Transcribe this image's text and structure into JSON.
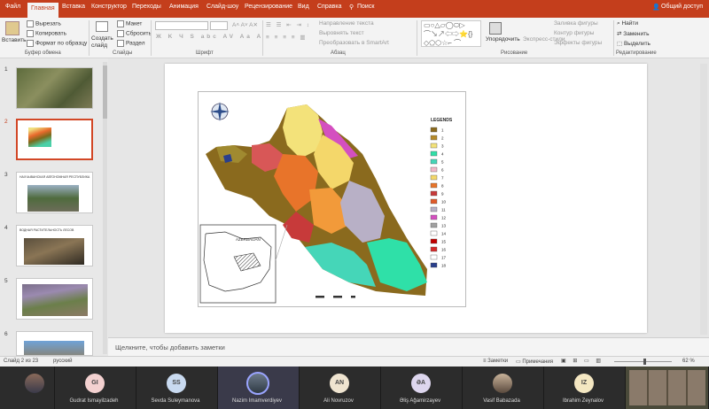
{
  "tabs": [
    "Файл",
    "Главная",
    "Вставка",
    "Конструктор",
    "Переходы",
    "Анимация",
    "Слайд-шоу",
    "Рецензирование",
    "Вид",
    "Справка",
    "Поиск"
  ],
  "share": "Общий доступ",
  "ribbon": {
    "paste": "Вставить",
    "cut": "Вырезать",
    "copy": "Копировать",
    "format": "Формат по образцу",
    "clipboard": "Буфер обмена",
    "new_slide": "Создать слайд",
    "layout": "Макет",
    "reset": "Сбросить",
    "section": "Раздел",
    "slides": "Слайды",
    "font": "Шрифт",
    "paragraph": "Абзац",
    "text_dir": "Направление текста",
    "align_text": "Выровнять текст",
    "smartart": "Преобразовать в SmartArt",
    "arrange": "Упорядочить",
    "quick_styles": "Экспресс-стили",
    "fill": "Заливка фигуры",
    "outline": "Контур фигуры",
    "effects": "Эффекты фигуры",
    "drawing": "Рисование",
    "find": "Найти",
    "replace": "Заменить",
    "select": "Выделить",
    "editing": "Редактирование"
  },
  "thumbnails": [
    {
      "num": "1",
      "caption": ""
    },
    {
      "num": "2",
      "caption": ""
    },
    {
      "num": "3",
      "caption": "НАХЧЫВАНСКАЯ АВТОНОМНАЯ РЕСПУБЛИКА"
    },
    {
      "num": "4",
      "caption": "ВОДНАЯ РАСТИТЕЛЬНОСТЬ ЛЕСОВ"
    },
    {
      "num": "5",
      "caption": ""
    },
    {
      "num": "6",
      "caption": ""
    }
  ],
  "map": {
    "legend_title": "LEGENDS",
    "legend": [
      "1",
      "2",
      "3",
      "4",
      "5",
      "6",
      "7",
      "8",
      "9",
      "10",
      "11",
      "12",
      "13",
      "14",
      "15",
      "16",
      "17",
      "18"
    ],
    "inset": "AZERBAIJAN"
  },
  "notes_placeholder": "Щелкните, чтобы добавить заметки",
  "status": {
    "slide": "Слайд 2 из 23",
    "lang": "русский",
    "notes": "Заметки",
    "comments": "Примечания",
    "zoom": "62 %"
  },
  "participants": [
    {
      "initials": "",
      "name": ""
    },
    {
      "initials": "GI",
      "name": "Gudrat Ismayilzadeh",
      "color": "#f3d1d0"
    },
    {
      "initials": "SS",
      "name": "Sevda Suleymanova",
      "color": "#c9daf0"
    },
    {
      "initials": "",
      "name": "Nazim Imamverdiyev"
    },
    {
      "initials": "AN",
      "name": "Ali Novruzov",
      "color": "#efe4d0"
    },
    {
      "initials": "ƏA",
      "name": "Əliş Ağamirzayev",
      "color": "#ddd6ee"
    },
    {
      "initials": "",
      "name": "Vasif Babazada"
    },
    {
      "initials": "IZ",
      "name": "Ibrahim Zeynalov",
      "color": "#f4e7c2"
    }
  ]
}
